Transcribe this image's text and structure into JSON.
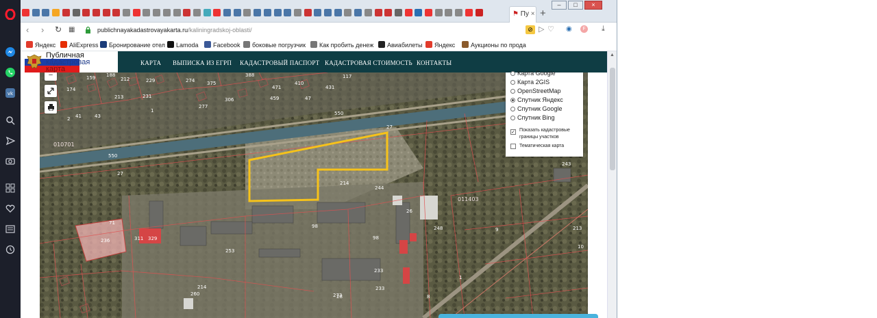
{
  "browser": {
    "tab_title": "Пу",
    "url_domain": "publichnayakadastrovayakarta.ru",
    "url_path": "/kaliningradskoj-oblasti/",
    "bookmarks": [
      {
        "label": "Яндекс",
        "icon": "yandex-icon",
        "color": "#e23b2b"
      },
      {
        "label": "AliExpress",
        "icon": "aliexpress-icon",
        "color": "#e62e04"
      },
      {
        "label": "Бронирование отел",
        "icon": "booking-icon",
        "color": "#1b3d7a"
      },
      {
        "label": "Lamoda",
        "icon": "lamoda-icon",
        "color": "#111111"
      },
      {
        "label": "Facebook",
        "icon": "facebook-icon",
        "color": "#3b5998"
      },
      {
        "label": "боковые погрузчик",
        "icon": "folder-icon",
        "color": "#777777"
      },
      {
        "label": "Как пробить денеж",
        "icon": "folder-icon",
        "color": "#777777"
      },
      {
        "label": "Авиабилеты",
        "icon": "plane-icon",
        "color": "#222222"
      },
      {
        "label": "Яндекс",
        "icon": "yandex-icon",
        "color": "#e23b2b"
      },
      {
        "label": "Аукционы по прода",
        "icon": "bag-icon",
        "color": "#8a5a2b"
      }
    ]
  },
  "site": {
    "logo_line1": "Публичная",
    "logo_line2": "кадастровая",
    "logo_line3": "карта",
    "menu": [
      "КАРТА",
      "ВЫПИСКА ИЗ ЕГРП",
      "КАДАСТРОВЫЙ ПАСПОРТ",
      "КАДАСТРОВАЯ СТОИМОСТЬ",
      "КОНТАКТЫ"
    ]
  },
  "map": {
    "layers": [
      {
        "label": "Карта Google",
        "selected": false
      },
      {
        "label": "Карта 2GIS",
        "selected": false
      },
      {
        "label": "OpenStreetMap",
        "selected": false
      },
      {
        "label": "Спутник Яндекс",
        "selected": true
      },
      {
        "label": "Спутник Google",
        "selected": false
      },
      {
        "label": "Спутник Bing",
        "selected": false
      }
    ],
    "checkbox_cadastral": "Показать кадастровые границы участков",
    "checkbox_cadastral_line1": "Показать кадастровые",
    "checkbox_cadastral_line2": "границы участков",
    "checkbox_thematic": "Тематическая карта",
    "quarter_labels": [
      "010701",
      "011403"
    ],
    "parcel_labels": [
      "159",
      "188",
      "212",
      "229",
      "274",
      "375",
      "388",
      "471",
      "431",
      "410",
      "117",
      "174",
      "213",
      "231",
      "277",
      "306",
      "459",
      "47",
      "41",
      "43",
      "1",
      "550",
      "27",
      "550",
      "27",
      "214",
      "244",
      "26",
      "248",
      "9",
      "236",
      "311",
      "329",
      "98",
      "98",
      "253",
      "233",
      "260",
      "214",
      "243",
      "213",
      "8",
      "1",
      "233",
      "28",
      "10",
      "273",
      "2",
      "71"
    ],
    "accent_color": "#f6c21a"
  }
}
